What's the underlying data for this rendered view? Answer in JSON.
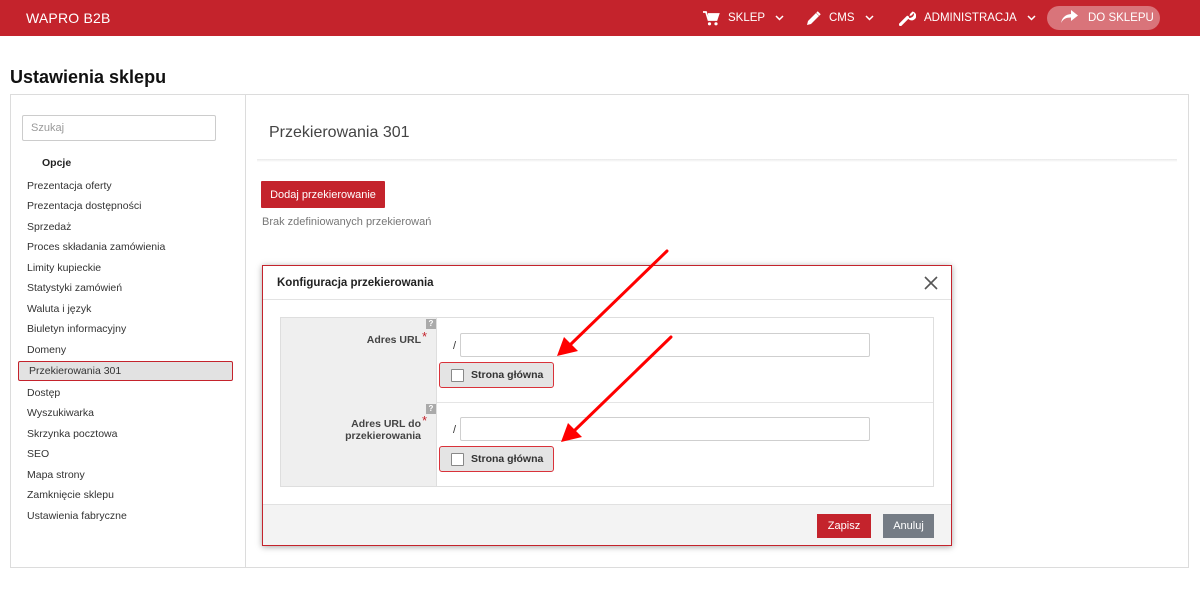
{
  "header": {
    "brand": "WAPRO B2B",
    "nav": [
      {
        "label": "SKLEP",
        "icon": "cart-icon"
      },
      {
        "label": "CMS",
        "icon": "pencil-icon"
      },
      {
        "label": "ADMINISTRACJA",
        "icon": "wrench-icon"
      }
    ],
    "shop_button": "DO SKLEPU"
  },
  "page_title": "Ustawienia sklepu",
  "sidebar": {
    "search_placeholder": "Szukaj",
    "section_title": "Opcje",
    "items": [
      "Prezentacja oferty",
      "Prezentacja dostępności",
      "Sprzedaż",
      "Proces składania zamówienia",
      "Limity kupieckie",
      "Statystyki zamówień",
      "Waluta i język",
      "Biuletyn informacyjny",
      "Domeny",
      "Przekierowania 301",
      "Dostęp",
      "Wyszukiwarka",
      "Skrzynka pocztowa",
      "SEO",
      "Mapa strony",
      "Zamknięcie sklepu",
      "Ustawienia fabryczne"
    ],
    "active_item": "Przekierowania 301"
  },
  "content": {
    "title": "Przekierowania 301",
    "add_button": "Dodaj przekierowanie",
    "empty_message": "Brak zdefiniowanych przekierowań"
  },
  "modal": {
    "title": "Konfiguracja przekierowania",
    "fields": [
      {
        "label": "Adres URL",
        "prefix": "/",
        "value": "",
        "checkbox_label": "Strona główna",
        "checked": false,
        "help": "?",
        "required_mark": "*"
      },
      {
        "label": "Adres URL do przekierowania",
        "prefix": "/",
        "value": "",
        "checkbox_label": "Strona główna",
        "checked": false,
        "help": "?",
        "required_mark": "*"
      }
    ],
    "save_button": "Zapisz",
    "cancel_button": "Anuluj"
  },
  "colors": {
    "brand": "#c4232c",
    "cancel": "#757c85",
    "annotation": "#ff0000"
  }
}
